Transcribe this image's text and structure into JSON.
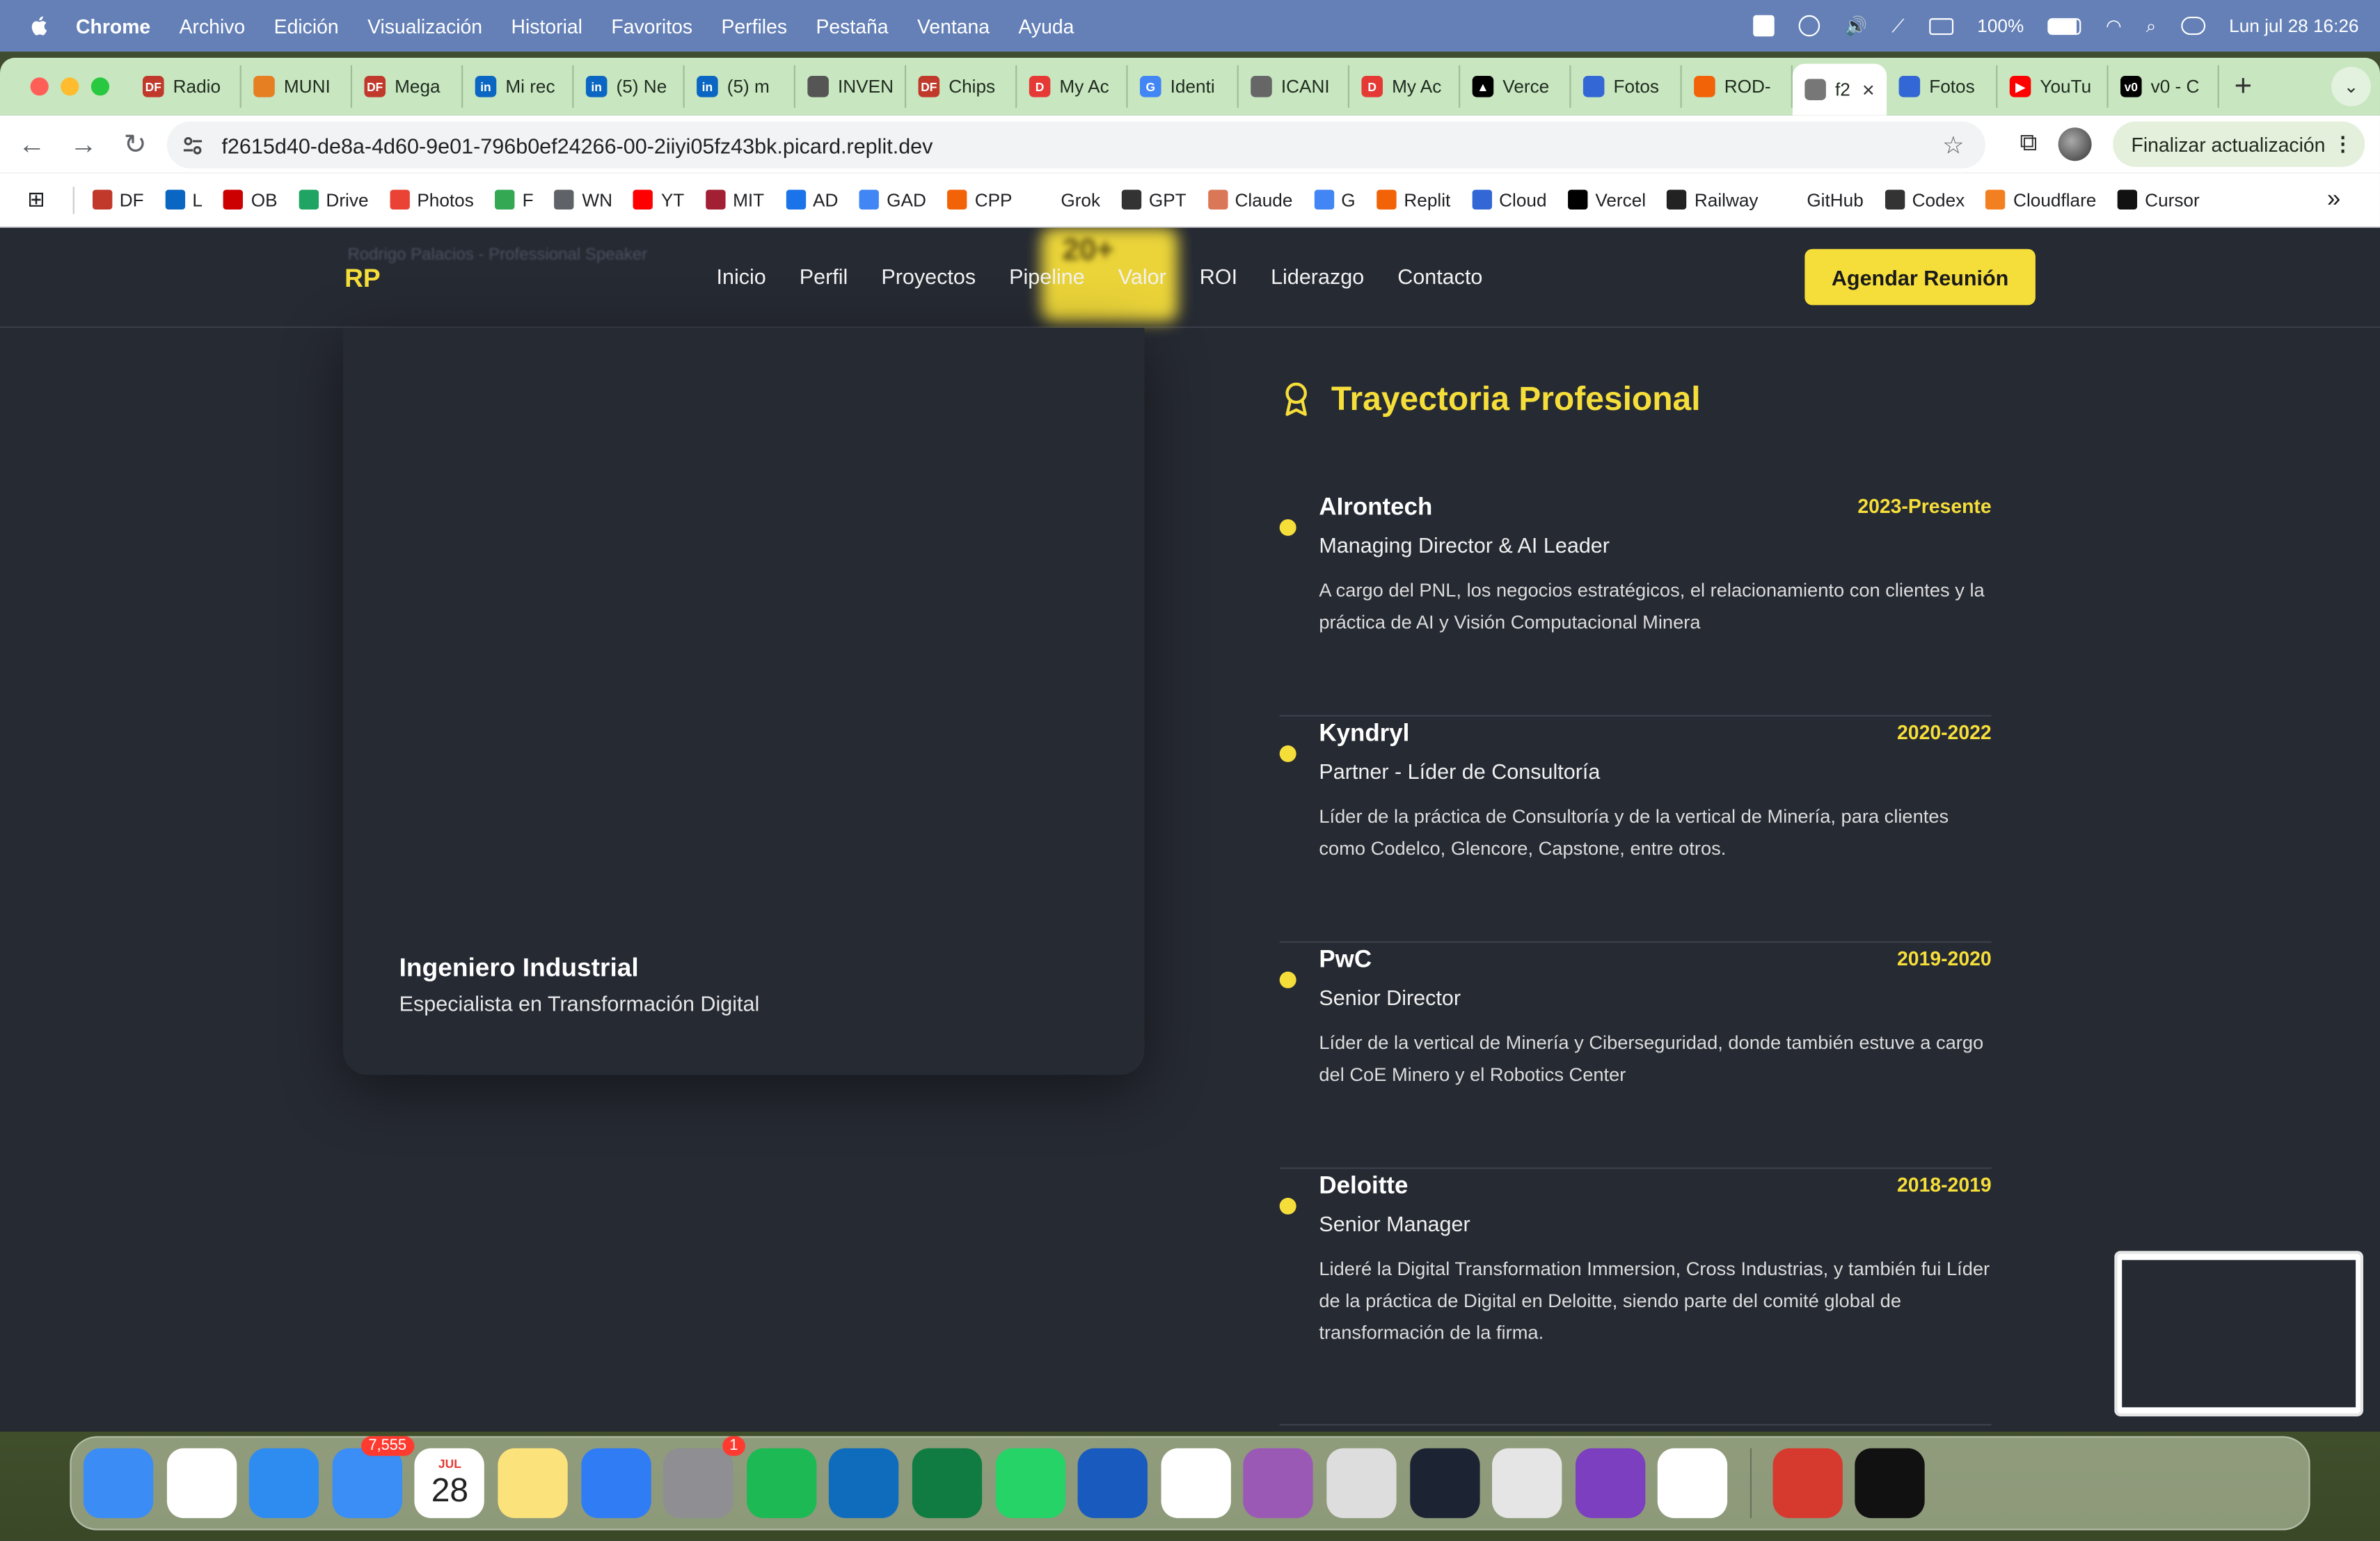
{
  "menubar": {
    "items": [
      "Chrome",
      "Archivo",
      "Edición",
      "Visualización",
      "Historial",
      "Favoritos",
      "Perfiles",
      "Pestaña",
      "Ventana",
      "Ayuda"
    ],
    "battery": "100%",
    "datetime": "Lun jul 28  16:26"
  },
  "browser": {
    "tabs": [
      {
        "label": "Radio",
        "color": "#c0392b",
        "icon": "DF"
      },
      {
        "label": "MUNI",
        "color": "#e67e22",
        "icon": ""
      },
      {
        "label": "Mega",
        "color": "#c0392b",
        "icon": "DF"
      },
      {
        "label": "Mi rec",
        "color": "#0a66c2",
        "icon": "in"
      },
      {
        "label": "(5) Ne",
        "color": "#0a66c2",
        "icon": "in"
      },
      {
        "label": "(5) m",
        "color": "#0a66c2",
        "icon": "in"
      },
      {
        "label": "INVEN",
        "color": "#555555",
        "icon": ""
      },
      {
        "label": "Chips",
        "color": "#c0392b",
        "icon": "DF"
      },
      {
        "label": "My Ac",
        "color": "#e53935",
        "icon": "D"
      },
      {
        "label": "Identi",
        "color": "#4285f4",
        "icon": "G"
      },
      {
        "label": "ICANI",
        "color": "#666666",
        "icon": ""
      },
      {
        "label": "My Ac",
        "color": "#e53935",
        "icon": "D"
      },
      {
        "label": "Verce",
        "color": "#000000",
        "icon": "▲"
      },
      {
        "label": "Fotos",
        "color": "#3367d6",
        "icon": ""
      },
      {
        "label": "ROD-",
        "color": "#f26207",
        "icon": ""
      },
      {
        "label": "f2",
        "color": "#777777",
        "icon": "",
        "active": true
      },
      {
        "label": "Fotos",
        "color": "#3367d6",
        "icon": ""
      },
      {
        "label": "YouTu",
        "color": "#ff0000",
        "icon": "▶"
      },
      {
        "label": "v0 - C",
        "color": "#000000",
        "icon": "v0"
      }
    ],
    "url": "f2615d40-de8a-4d60-9e01-796b0ef24266-00-2iiyi05fz43bk.picard.replit.dev",
    "update_label": "Finalizar actualización",
    "bookmarks": [
      {
        "label": "DF",
        "color": "#c0392b"
      },
      {
        "label": "L",
        "color": "#0a66c2"
      },
      {
        "label": "OB",
        "color": "#cc0000"
      },
      {
        "label": "Drive",
        "color": "#1fa463"
      },
      {
        "label": "Photos",
        "color": "#ea4335"
      },
      {
        "label": "F",
        "color": "#34a853"
      },
      {
        "label": "WN",
        "color": "#5f6368"
      },
      {
        "label": "YT",
        "color": "#ff0000"
      },
      {
        "label": "MIT",
        "color": "#a31f34"
      },
      {
        "label": "AD",
        "color": "#1a73e8"
      },
      {
        "label": "GAD",
        "color": "#4285f4"
      },
      {
        "label": "CPP",
        "color": "#f26207"
      },
      {
        "label": "Grok",
        "color": "#ffffff"
      },
      {
        "label": "GPT",
        "color": "#333333"
      },
      {
        "label": "Claude",
        "color": "#d97757"
      },
      {
        "label": "G",
        "color": "#4285f4"
      },
      {
        "label": "Replit",
        "color": "#f26207"
      },
      {
        "label": "Cloud",
        "color": "#3367d6"
      },
      {
        "label": "Vercel",
        "color": "#000000"
      },
      {
        "label": "Railway",
        "color": "#222222"
      },
      {
        "label": "GitHub",
        "color": "#ffffff"
      },
      {
        "label": "Codex",
        "color": "#333333"
      },
      {
        "label": "Cloudflare",
        "color": "#f38020"
      },
      {
        "label": "Cursor",
        "color": "#111111"
      }
    ]
  },
  "site": {
    "logo": "RP",
    "broken_image_alt": "Rodrigo Palacios - Professional Speaker",
    "nav": [
      "Inicio",
      "Perfil",
      "Proyectos",
      "Pipeline",
      "Valor",
      "ROI",
      "Liderazgo",
      "Contacto"
    ],
    "blurred_stat": "20+",
    "cta": "Agendar Reunión",
    "profile_card": {
      "title": "Ingeniero Industrial",
      "subtitle": "Especialista en Transformación Digital"
    },
    "section_title": "Trayectoria Profesional",
    "jobs": [
      {
        "company": "AIrontech",
        "period": "2023-Presente",
        "role": "Managing Director & AI Leader",
        "description": "A cargo del PNL, los negocios estratégicos, el relacionamiento con clientes y la práctica de AI y Visión Computacional Minera"
      },
      {
        "company": "Kyndryl",
        "period": "2020-2022",
        "role": "Partner - Líder de Consultoría",
        "description": "Líder de la práctica de Consultoría y de la vertical de Minería, para clientes como Codelco, Glencore, Capstone, entre otros."
      },
      {
        "company": "PwC",
        "period": "2019-2020",
        "role": "Senior Director",
        "description": "Líder de la vertical de Minería y Ciberseguridad, donde también estuve a cargo del CoE Minero y el Robotics Center"
      },
      {
        "company": "Deloitte",
        "period": "2018-2019",
        "role": "Senior Manager",
        "description": "Lideré la Digital Transformation Immersion, Cross Industrias, y también fui Líder de la práctica de Digital en Deloitte, siendo parte del comité global de transformación de la firma."
      }
    ]
  },
  "dock": {
    "mail_badge": "7,555",
    "calendar_month": "JUL",
    "calendar_day": "28",
    "settings_badge": "1",
    "apps": [
      {
        "name": "finder",
        "color": "#3b8cf5"
      },
      {
        "name": "chrome",
        "color": "#ffffff"
      },
      {
        "name": "safari",
        "color": "#2e8cf0"
      },
      {
        "name": "mail",
        "color": "#3a8ef6"
      },
      {
        "name": "calendar",
        "color": "#ffffff"
      },
      {
        "name": "notes",
        "color": "#fbe27a"
      },
      {
        "name": "keynote",
        "color": "#2f7cf5"
      },
      {
        "name": "system-settings",
        "color": "#8e8e93"
      },
      {
        "name": "spotify",
        "color": "#1db954"
      },
      {
        "name": "outlook",
        "color": "#0f6cbd"
      },
      {
        "name": "excel",
        "color": "#107c41"
      },
      {
        "name": "whatsapp",
        "color": "#25d366"
      },
      {
        "name": "word",
        "color": "#185abd"
      },
      {
        "name": "fantastical",
        "color": "#ffffff"
      },
      {
        "name": "screen-recorder",
        "color": "#9b59b6"
      },
      {
        "name": "simulator",
        "color": "#dddddd"
      },
      {
        "name": "replit",
        "color": "#1c2333"
      },
      {
        "name": "parallels",
        "color": "#e5e5e5"
      },
      {
        "name": "github-desktop",
        "color": "#7b3fbf"
      },
      {
        "name": "vscode",
        "color": "#ffffff"
      },
      {
        "name": "photo-booth",
        "color": "#d63a2f"
      },
      {
        "name": "cube-app",
        "color": "#111111"
      }
    ]
  }
}
